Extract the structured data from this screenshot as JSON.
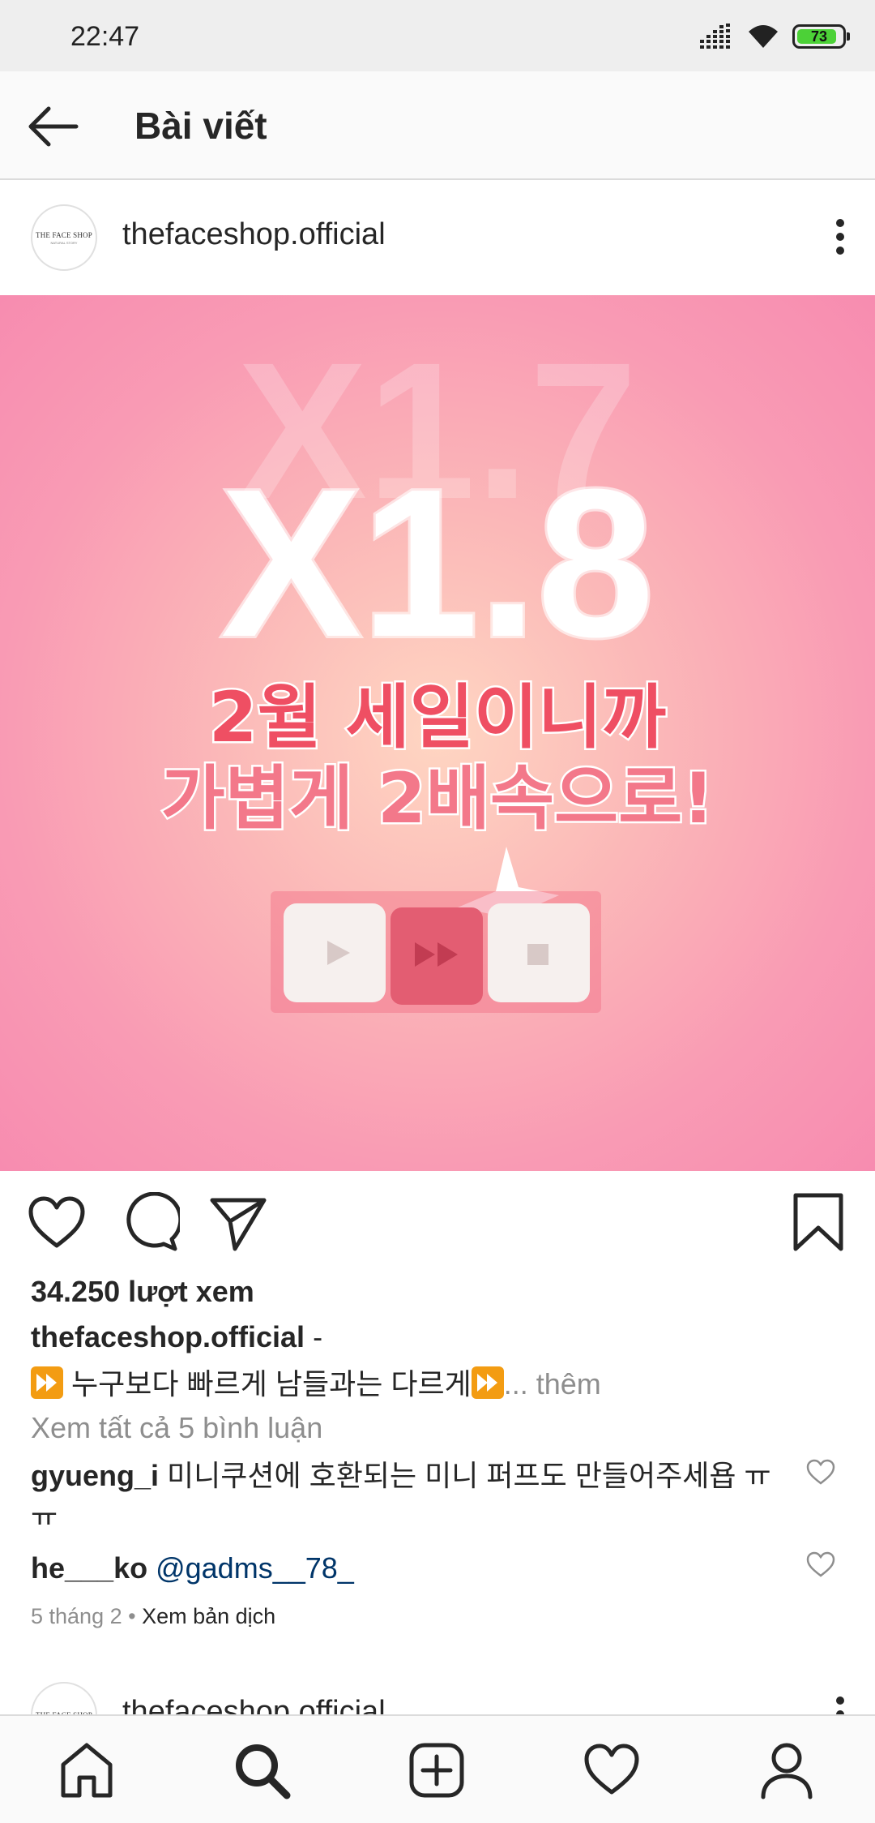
{
  "status_bar": {
    "time": "22:47",
    "battery_level": "73",
    "icons": [
      "signal-icon",
      "wifi-icon",
      "battery-icon"
    ]
  },
  "header": {
    "back_icon": "arrow-left-icon",
    "title": "Bài viết"
  },
  "post": {
    "avatar_text": "THE FACE SHOP",
    "avatar_subtext": "NATURAL STORY",
    "username": "thefaceshop.official",
    "menu_icon": "more-vertical-icon",
    "image": {
      "big_text_back": "X1.7",
      "big_text_front": "X1.8",
      "korean_line1": "2월 세일이니까",
      "korean_line2": "가볍게 2배속으로!",
      "buttons": [
        "play-icon",
        "fast-forward-icon",
        "stop-icon"
      ]
    },
    "actions": [
      "heart-icon",
      "comment-icon",
      "share-icon",
      "bookmark-icon"
    ],
    "views": "34.250 lượt xem",
    "caption_user": "thefaceshop.official",
    "caption_dash": " -",
    "caption_text": " 누구보다 빠르게 남들과는 다르게",
    "caption_more": "... thêm",
    "view_all_comments": "Xem tất cả 5 bình luận",
    "comments": [
      {
        "user": "gyueng_i",
        "text": " 미니쿠션에 호환되는 미니 퍼프도 만들어주세욥 ㅠㅠ"
      },
      {
        "user": "he___ko",
        "mention": " @gadms__78_"
      }
    ],
    "date": "5 tháng 2",
    "separator": " • ",
    "translate": "Xem bản dịch"
  },
  "next_post": {
    "username": "thefaceshop.official"
  },
  "bottom_nav": [
    "home-icon",
    "search-icon",
    "add-post-icon",
    "activity-heart-icon",
    "profile-icon"
  ],
  "colors": {
    "accent_pink": "#f78cb0",
    "mention_blue": "#003569",
    "muted_gray": "#8e8e8e",
    "battery_green": "#4cd137"
  }
}
